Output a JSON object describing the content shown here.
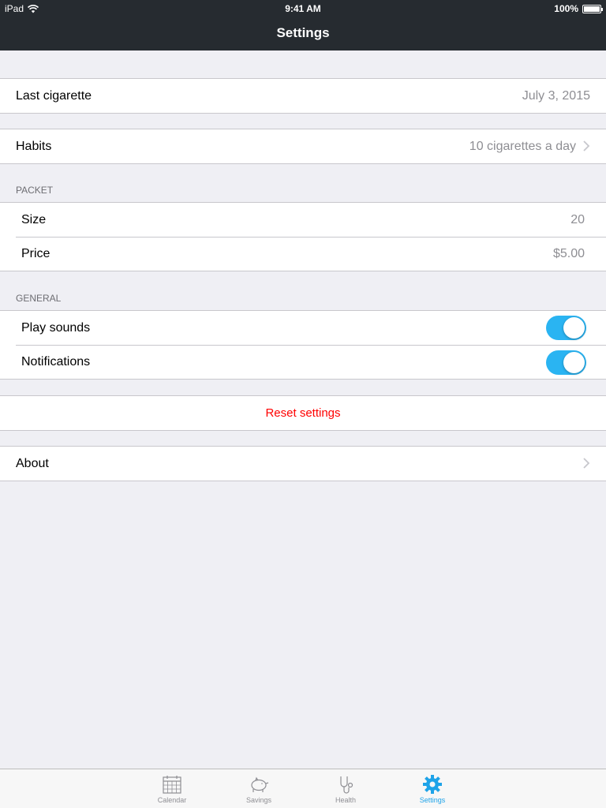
{
  "status_bar": {
    "device": "iPad",
    "time": "9:41 AM",
    "battery": "100%"
  },
  "nav": {
    "title": "Settings"
  },
  "last_cigarette": {
    "label": "Last cigarette",
    "value": "July 3, 2015"
  },
  "habits": {
    "label": "Habits",
    "value": "10 cigarettes a day"
  },
  "packet": {
    "header": "PACKET",
    "size": {
      "label": "Size",
      "value": "20"
    },
    "price": {
      "label": "Price",
      "value": "$5.00"
    }
  },
  "general": {
    "header": "GENERAL",
    "play_sounds": {
      "label": "Play sounds",
      "on": true
    },
    "notifications": {
      "label": "Notifications",
      "on": true
    }
  },
  "reset": {
    "label": "Reset settings",
    "color": "#ff0000"
  },
  "about": {
    "label": "About"
  },
  "tabs": [
    {
      "label": "Calendar",
      "icon": "calendar-icon",
      "active": false
    },
    {
      "label": "Savings",
      "icon": "piggy-bank-icon",
      "active": false
    },
    {
      "label": "Health",
      "icon": "stethoscope-icon",
      "active": false
    },
    {
      "label": "Settings",
      "icon": "gear-icon",
      "active": true
    }
  ],
  "colors": {
    "accent": "#2ab4f2",
    "nav_bg": "#262b30"
  }
}
